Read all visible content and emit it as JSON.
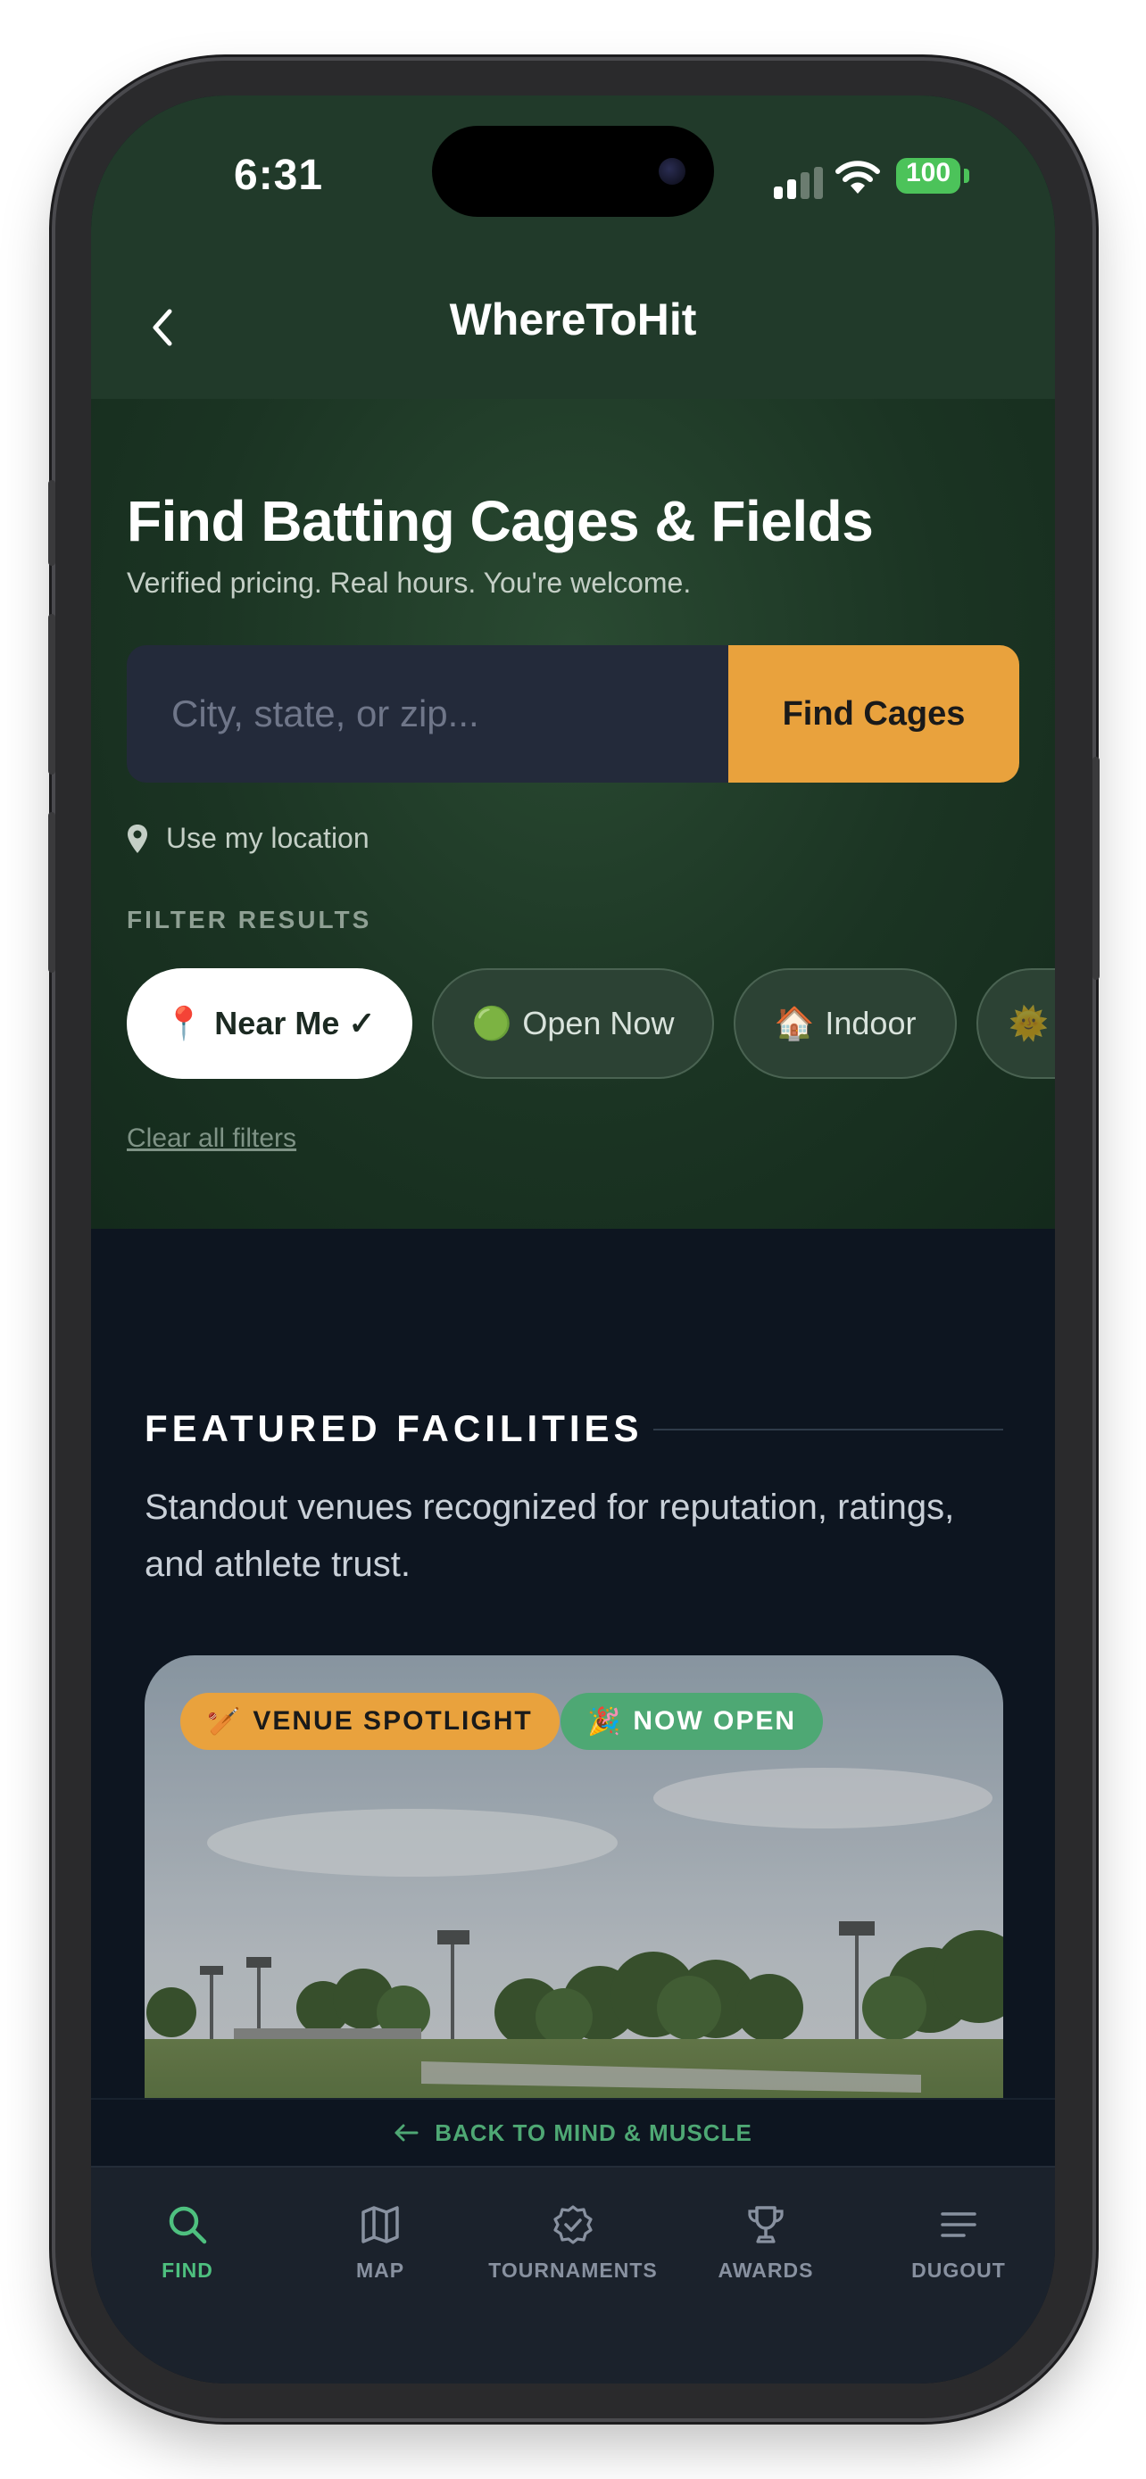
{
  "status_bar": {
    "time": "6:31",
    "battery": "100"
  },
  "header": {
    "title": "WhereToHit"
  },
  "hero": {
    "title": "Find Batting Cages & Fields",
    "subtitle": "Verified pricing. Real hours. You're welcome.",
    "search": {
      "placeholder": "City, state, or zip...",
      "button": "Find Cages"
    },
    "use_location": "Use my location",
    "filter_label": "FILTER RESULTS",
    "filters": [
      {
        "emoji": "📍",
        "label": "Near Me ✓",
        "active": true
      },
      {
        "emoji": "🟢",
        "label": "Open Now",
        "active": false
      },
      {
        "emoji": "🏠",
        "label": "Indoor",
        "active": false
      },
      {
        "emoji": "🌞",
        "label": "",
        "active": false
      }
    ],
    "clear_filters": "Clear all filters"
  },
  "featured": {
    "heading": "FEATURED FACILITIES",
    "description": "Standout venues recognized for reputation, ratings, and athlete trust.",
    "badges": {
      "spotlight": {
        "emoji": "🏏",
        "label": "VENUE SPOTLIGHT"
      },
      "open": {
        "emoji": "🎉",
        "label": "NOW OPEN"
      }
    }
  },
  "back_link": "BACK TO MIND & MUSCLE",
  "tabs": [
    {
      "label": "FIND",
      "icon": "search-icon",
      "active": true
    },
    {
      "label": "MAP",
      "icon": "map-icon",
      "active": false
    },
    {
      "label": "TOURNAMENTS",
      "icon": "badge-check-icon",
      "active": false
    },
    {
      "label": "AWARDS",
      "icon": "trophy-icon",
      "active": false
    },
    {
      "label": "DUGOUT",
      "icon": "menu-icon",
      "active": false
    }
  ],
  "colors": {
    "accent_orange": "#e9a23d",
    "accent_green": "#4ec07f",
    "hero_green": "#1b3423",
    "dark_bg": "#0d1520"
  }
}
